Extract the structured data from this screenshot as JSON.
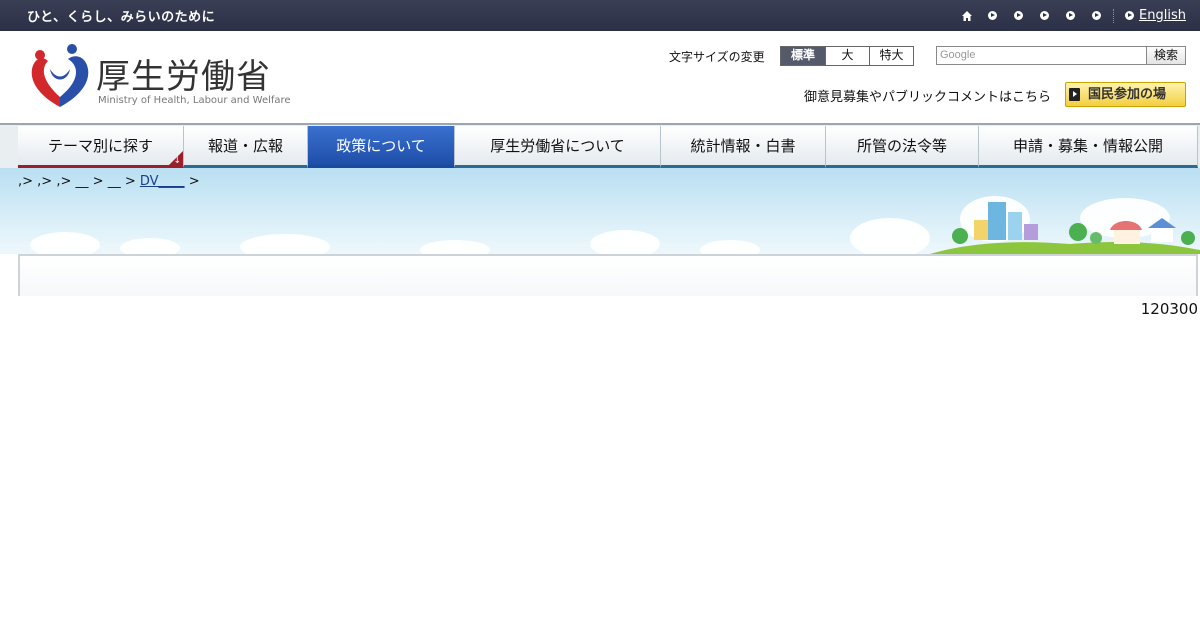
{
  "topbar": {
    "tagline": "ひと、くらし、みらいのために",
    "english": "English"
  },
  "header": {
    "logo_title": "厚生労働省",
    "logo_subtitle": "Ministry of Health, Labour and Welfare",
    "fontsize_label": "文字サイズの変更",
    "fontsize_options": [
      "標準",
      "大",
      "特大"
    ],
    "search_placeholder": "Google",
    "search_button": "検索",
    "opinion_link": "御意見募集やパブリックコメントはこちら",
    "kokumin_button": "国民参加の場"
  },
  "gnav": {
    "items": [
      "テーマ別に探す",
      "報道・広報",
      "政策について",
      "厚生労働省について",
      "統計情報・白書",
      "所管の法令等",
      "申請・募集・情報公開"
    ]
  },
  "breadcrumb": {
    "seps": [
      ",>",
      ",>",
      ",>",
      "__ >",
      "__ >"
    ],
    "link": "DV____",
    "tail": ">"
  },
  "counter": "120300",
  "colors": {
    "topbar": "#2b3046",
    "nav_active": "#1e4fa8",
    "nav_theme_accent": "#9b1f2a",
    "kokumin_yellow": "#f2cf3f"
  }
}
